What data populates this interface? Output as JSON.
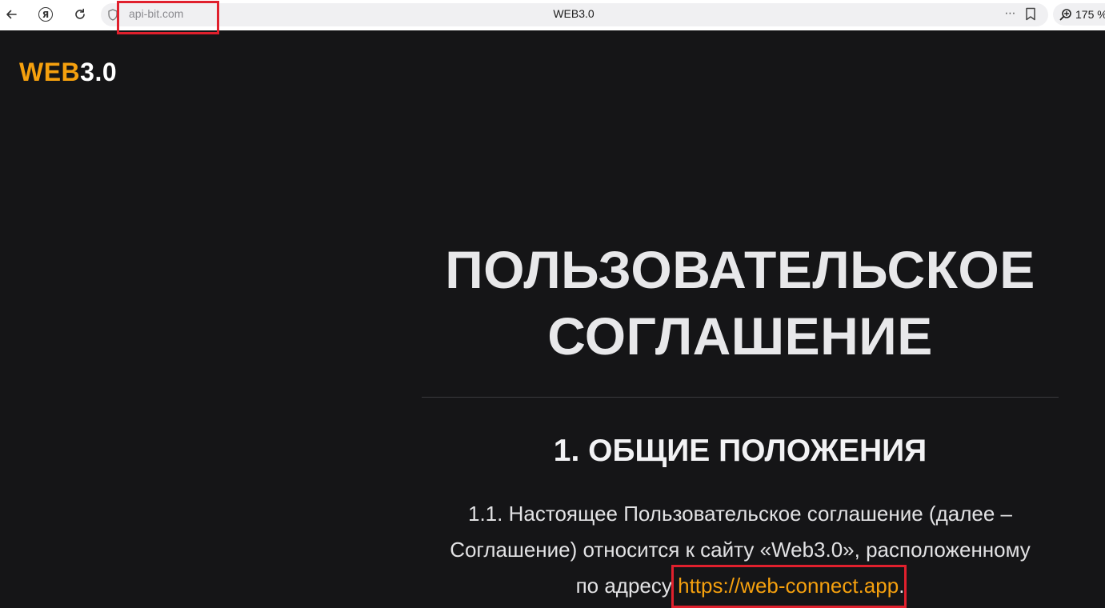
{
  "browser": {
    "tab_title": "WEB3.0",
    "address": "api-bit.com",
    "zoom": "175 %",
    "more_label": "⋯"
  },
  "logo": {
    "part1": "WEB",
    "part2": "3.0"
  },
  "content": {
    "title_line1": "ПОЛЬЗОВАТЕЛЬСКОЕ",
    "title_line2": "СОГЛАШЕНИЕ",
    "section_heading": "1. ОБЩИЕ ПОЛОЖЕНИЯ",
    "para_line1": "1.1. Настоящее Пользовательское соглашение (далее –",
    "para_line2": "Соглашение) относится к сайту «Web3.0», расположенному",
    "para_line3_prefix": "по адресу ",
    "link_text": "https://web-connect.app",
    "para_line3_suffix": "."
  },
  "colors": {
    "page_background": "#151517",
    "brand_orange": "#f5a00e",
    "highlight_red": "#e0202d"
  }
}
